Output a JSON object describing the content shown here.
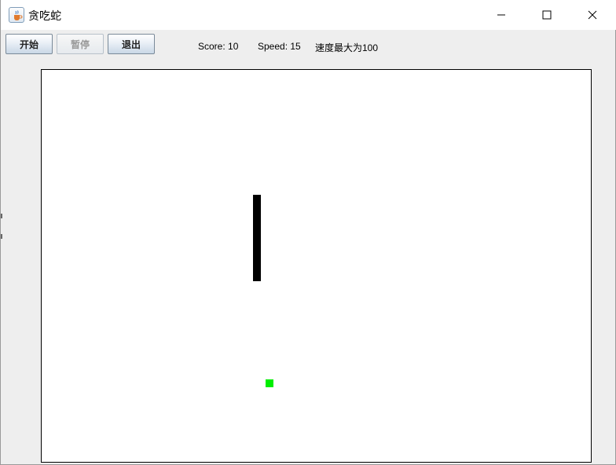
{
  "window": {
    "title": "贪吃蛇",
    "icon": "java-cup-icon"
  },
  "controls": {
    "minimize": "minimize-icon",
    "maximize": "maximize-icon",
    "close": "close-icon"
  },
  "toolbar": {
    "start_label": "开始",
    "pause_label": "暂停",
    "exit_label": "退出"
  },
  "status": {
    "score_text": "Score: 10",
    "speed_text": "Speed: 15",
    "speed_note": "速度最大为100"
  },
  "game": {
    "board_color": "#ffffff",
    "snake_color": "#000000",
    "food_color": "#00ee00",
    "snake_direction": "vertical",
    "snake_length_cells": 11
  }
}
